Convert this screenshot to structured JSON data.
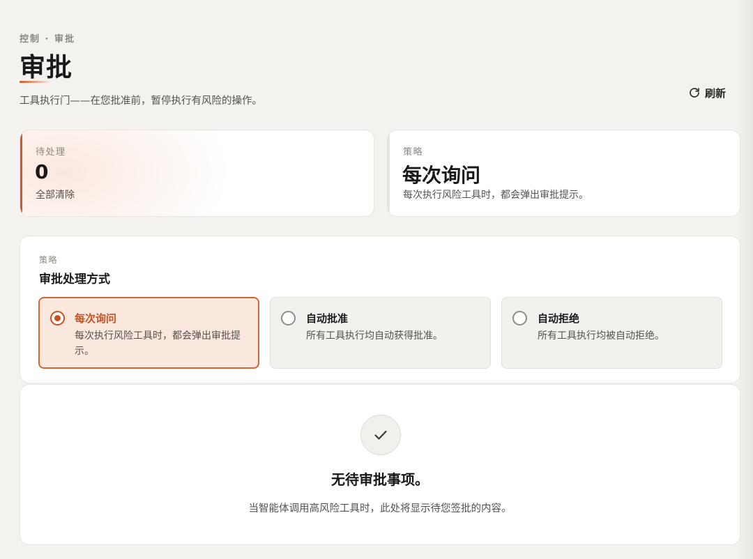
{
  "header": {
    "breadcrumb": "控制 · 审批",
    "title": "审批",
    "subtitle": "工具执行门——在您批准前，暂停执行有风险的操作。",
    "refresh_label": "刷新",
    "refresh_icon": "refresh-icon"
  },
  "summary": {
    "pending": {
      "label": "待处理",
      "count": "0",
      "note": "全部清除"
    },
    "strategy": {
      "label": "策略",
      "value": "每次询问",
      "description": "每次执行风险工具时，都会弹出审批提示。"
    }
  },
  "policy": {
    "label": "策略",
    "title": "审批处理方式",
    "selected": 0,
    "options": [
      {
        "title": "每次询问",
        "description": "每次执行风险工具时，都会弹出审批提示。"
      },
      {
        "title": "自动批准",
        "description": "所有工具执行均自动获得批准。"
      },
      {
        "title": "自动拒绝",
        "description": "所有工具执行均被自动拒绝。"
      }
    ]
  },
  "empty_state": {
    "icon": "check-icon",
    "title": "无待审批事项。",
    "description": "当智能体调用高风险工具时，此处将显示待您签批的内容。"
  },
  "colors": {
    "accent": "#d1582a",
    "background": "#f4f2ef",
    "selected_option_bg": "#fae7de"
  }
}
